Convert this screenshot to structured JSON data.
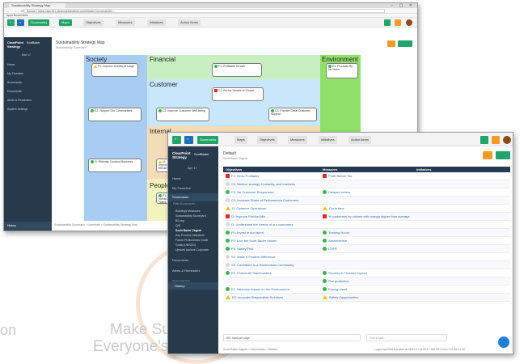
{
  "background": {
    "tagline_1": "Make Sus",
    "tagline_2": "Everyone's",
    "left_fragment": "on"
  },
  "back_window": {
    "tab_title": "Sustainability Strategy Map",
    "url": "Secure | https://app151.clearpointstrategy.com/#/index?scorecardId=...",
    "bookmarks": "Apps  Bookmarks",
    "toolbar": {
      "scorecards": "Scorecards",
      "maps": "Maps",
      "objectives": "Objectives",
      "measures": "Measures",
      "initiatives": "Initiatives",
      "action_items": "Action Items"
    },
    "sidebar": {
      "logo_1": "ClearPoint",
      "logo_2": "Strategy",
      "org": "ScotBader",
      "period": "Mar 17",
      "items": [
        "Home",
        "My Favorites",
        "Scorecards",
        "Documents",
        "Alerts & Reminders",
        "System Settings"
      ],
      "history": "History"
    },
    "page_title": "Sustainability Strategy Map",
    "page_subtitle": "Sustainability Scorecard",
    "breadcrumb": "Sustainability Scorecard > Lineofsite > Sustainability Strategy Map",
    "perspectives": [
      "Society",
      "Financial",
      "Environment",
      "Customer",
      "Internal",
      "People"
    ],
    "boxes": [
      {
        "text": "F1: Improve Society at Large",
        "status": "y"
      },
      {
        "text": "F1: Profitable Growth",
        "status": "g"
      },
      {
        "text": "E1: Products By No Harm",
        "status": "g"
      },
      {
        "text": "C1: Be the Vendor of Choice",
        "status": "r"
      },
      {
        "text": "S2: Support Our Communities",
        "status": "g"
      },
      {
        "text": "C2: Improve Customer Well-being",
        "status": "g"
      },
      {
        "text": "C3: Provide Great Customer Support",
        "status": "g"
      },
      {
        "text": "I1: Ethically Conduct Business",
        "status": "g"
      },
      {
        "text": "I2: Improve Efficiency",
        "status": "y"
      },
      {
        "text": "P1: Invest in Talent",
        "status": "g"
      }
    ]
  },
  "front_window": {
    "toolbar": {
      "scorecards": "Scorecards",
      "maps": "Maps",
      "objectives": "Objectives",
      "measures": "Measures",
      "initiatives": "Initiatives",
      "action_items": "Action Items"
    },
    "sidebar": {
      "logo_1": "ClearPoint",
      "logo_2": "Strategy",
      "org": "ScotBader",
      "period": "Apr 17",
      "items": [
        "Home",
        "My Favorites",
        "Scorecards"
      ],
      "filter": "Filter Scorecards...",
      "sub_items": [
        "Buildings Measures",
        "Sustainability Scorecard",
        "BS org",
        "Q/B",
        "Scott Bader Zagreb",
        "Key Process Indicators",
        "Future Fit Business Guide",
        "Goals (UNSDG)",
        "Upward Archive Corporate"
      ],
      "items2": [
        "Documents",
        "Alerts & Reminders"
      ],
      "section": "Recent Activities",
      "history": "History"
    },
    "page_title": "Default",
    "page_subtitle": "Scott Bader Zagreb",
    "columns": [
      "Objectives",
      "Measures",
      "Initiatives"
    ],
    "rows": [
      {
        "objective": "F1: Grow Profitably",
        "obj_status": "r",
        "measure": "Profit Before Tax",
        "meas_status": "r"
      },
      {
        "objective": "C1: Believe ecology, humanity, and business",
        "obj_status": "x",
        "measure": "",
        "meas_status": ""
      },
      {
        "objective": "C2: Be Customer Responsive",
        "obj_status": "g",
        "measure": "Delayed orders",
        "meas_status": "g"
      },
      {
        "objective": "C4: Increase Share of Performance Customers",
        "obj_status": "x",
        "measure": "",
        "meas_status": ""
      },
      {
        "objective": "I1: Optimize Operations",
        "obj_status": "y",
        "measure": "Cycle time",
        "meas_status": "y"
      },
      {
        "objective": "I2: Improve Product Mix",
        "obj_status": "r",
        "measure": "% customers by volume with margin higher than average",
        "meas_status": "r"
      },
      {
        "objective": "I3: Understand the Needs of our customers",
        "obj_status": "x",
        "measure": "",
        "meas_status": ""
      },
      {
        "objective": "P1: Invest in our talent",
        "obj_status": "g",
        "measure": "Training Hours",
        "meas_status": "g"
      },
      {
        "objective": "P2: Live the Scott Bader Values",
        "obj_status": "g",
        "measure": "Absenteeism",
        "meas_status": "g"
      },
      {
        "objective": "P3: Safety First",
        "obj_status": "g",
        "measure": "LTIFR",
        "meas_status": "g"
      },
      {
        "objective": "S1: Make a Positive Difference",
        "obj_status": "x",
        "measure": "",
        "meas_status": ""
      },
      {
        "objective": "S2: Contribute to a Harmonious Community",
        "obj_status": "x",
        "measure": "",
        "meas_status": ""
      },
      {
        "objective": "E3: Protect All Stakeholders",
        "obj_status": "g",
        "measure": "Security & Finished Injured",
        "meas_status": "g"
      },
      {
        "objective": "",
        "obj_status": "",
        "measure": "Fire protection",
        "meas_status": "g"
      },
      {
        "objective": "E1: Minimize Impact on the Environment",
        "obj_status": "g",
        "measure": "Energy Used",
        "meas_status": "g"
      },
      {
        "objective": "E2: Innovate Responsible Solutions",
        "obj_status": "y",
        "measure": "Safety Opportunities",
        "meas_status": "y"
      }
    ],
    "per_page": "50+ rows per page",
    "find": "Find in grid...",
    "footer_left": "Scott Bader Zagreb > Scorecards > Default",
    "footer_right": "Logon by Brett Knowles at 05/11/17 at 09:17 AM EST from 173.48.31.29"
  }
}
